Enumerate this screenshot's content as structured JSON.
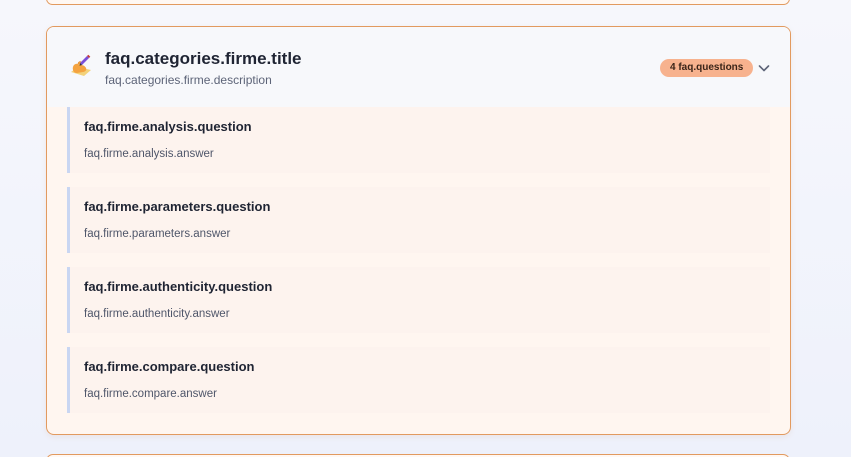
{
  "category": {
    "title": "faq.categories.firme.title",
    "description": "faq.categories.firme.description",
    "icon": "writing-hand-icon",
    "badge": "4 faq.questions",
    "accent_color": "#e29a5f",
    "badge_color": "#f7b28e"
  },
  "questions": [
    {
      "question": "faq.firme.analysis.question",
      "answer": "faq.firme.analysis.answer"
    },
    {
      "question": "faq.firme.parameters.question",
      "answer": "faq.firme.parameters.answer"
    },
    {
      "question": "faq.firme.authenticity.question",
      "answer": "faq.firme.authenticity.answer"
    },
    {
      "question": "faq.firme.compare.question",
      "answer": "faq.firme.compare.answer"
    }
  ]
}
